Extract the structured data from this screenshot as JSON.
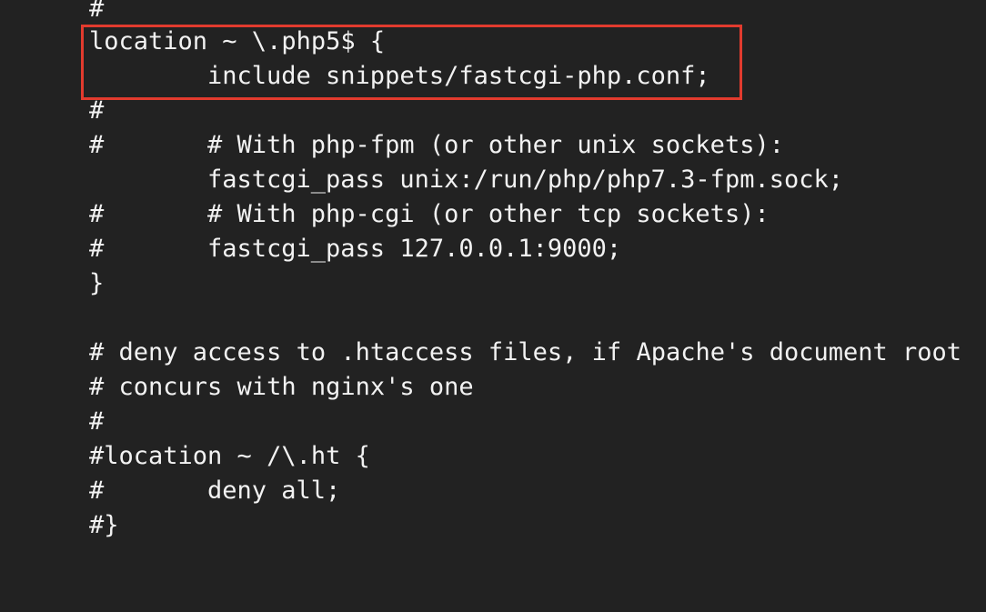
{
  "lines": [
    {
      "gutter": "#",
      "text": ""
    },
    {
      "gutter": "",
      "text": "location ~ \\.php5$ {"
    },
    {
      "gutter": "",
      "text": "include snippets/fastcgi-php.conf;"
    },
    {
      "gutter": "#",
      "text": ""
    },
    {
      "gutter": "#",
      "text": "# With php-fpm (or other unix sockets):"
    },
    {
      "gutter": "",
      "text": "fastcgi_pass unix:/run/php/php7.3-fpm.sock;"
    },
    {
      "gutter": "#",
      "text": "# With php-cgi (or other tcp sockets):"
    },
    {
      "gutter": "#",
      "text": "fastcgi_pass 127.0.0.1:9000;"
    },
    {
      "gutter": "",
      "text": "}"
    },
    {
      "gutter": "",
      "text": ""
    },
    {
      "gutter": "",
      "text": "# deny access to .htaccess files, if Apache's document root"
    },
    {
      "gutter": "",
      "text": "# concurs with nginx's one"
    },
    {
      "gutter": "#",
      "text": ""
    },
    {
      "gutter": "",
      "text": "#location ~ /\\.ht {"
    },
    {
      "gutter": "#",
      "text": "deny all;"
    },
    {
      "gutter": "",
      "text": "#}"
    }
  ],
  "highlight_color": "#e23b2e"
}
